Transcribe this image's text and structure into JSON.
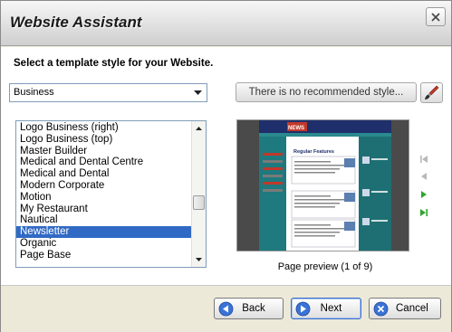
{
  "window": {
    "title": "Website Assistant"
  },
  "prompt": "Select a template style for your Website.",
  "category_select": {
    "value": "Business"
  },
  "recommend_button": {
    "label": "There is no recommended style..."
  },
  "template_list": {
    "items": [
      "Logo Business (right)",
      "Logo Business (top)",
      "Master Builder",
      "Medical and Dental Centre",
      "Medical and Dental",
      "Modern Corporate",
      "Motion",
      "My Restaurant",
      "Nautical",
      "Newsletter",
      "Organic",
      "Page Base"
    ],
    "selected": "Newsletter"
  },
  "preview": {
    "caption": "Page preview (1 of 9)",
    "thumb_heading": "Regular Features",
    "thumb_logo": "NEWS"
  },
  "colors": {
    "selection": "#316ac5",
    "preview_teal": "#1e7a7e",
    "preview_navy": "#1f2f6b",
    "nav_green": "#2fa52f"
  },
  "buttons": {
    "back": "Back",
    "next": "Next",
    "cancel": "Cancel"
  },
  "icons": {
    "close": "close-icon",
    "brush": "paintbrush-icon",
    "first": "first-page-icon",
    "prev": "previous-page-icon",
    "next": "next-page-icon",
    "last": "last-page-icon"
  }
}
